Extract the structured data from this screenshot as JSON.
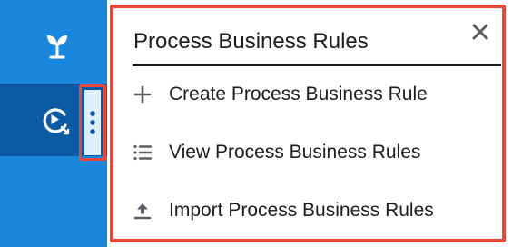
{
  "popup": {
    "title": "Process Business Rules",
    "items": [
      {
        "label": "Create Process Business Rule",
        "icon": "plus-icon"
      },
      {
        "label": "View Process Business Rules",
        "icon": "list-icon"
      },
      {
        "label": "Import Process Business Rules",
        "icon": "upload-icon"
      }
    ]
  },
  "sidebar": {
    "items": [
      {
        "icon": "sprout-icon"
      },
      {
        "icon": "process-play-icon",
        "active": true
      }
    ]
  },
  "colors": {
    "sidebar": "#1b87dc",
    "sidebar_active": "#0b5ba4",
    "highlight": "#e8483a",
    "kebab_bg": "#dfeefb",
    "kebab_dots": "#0b5ba4",
    "text": "#1d1d1f"
  }
}
